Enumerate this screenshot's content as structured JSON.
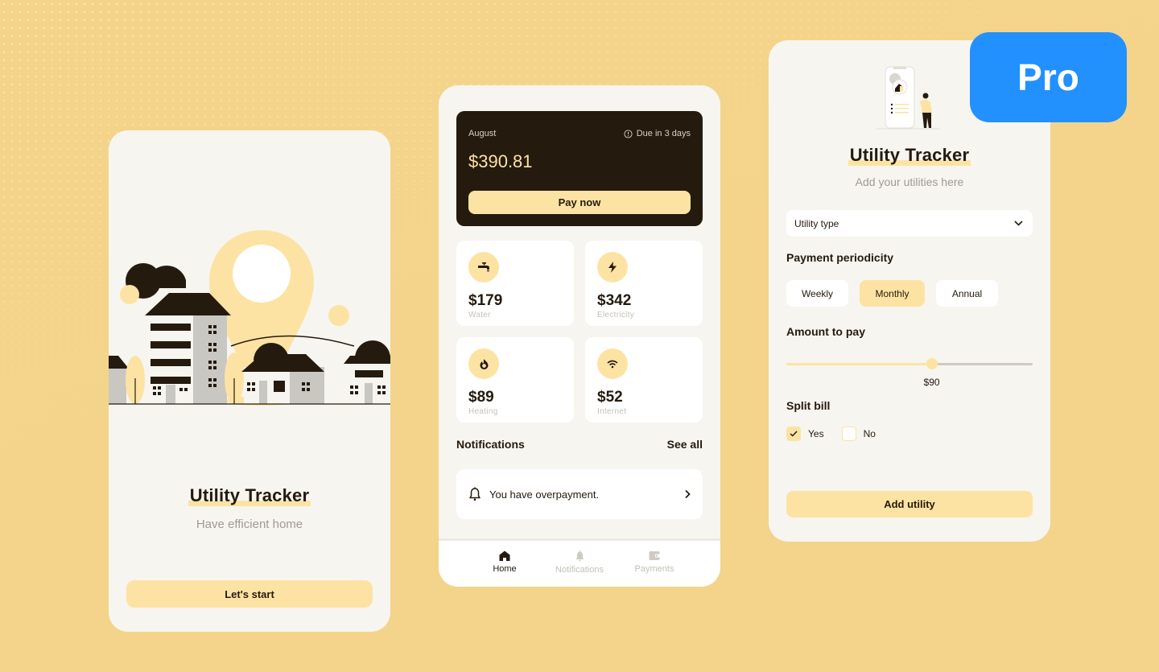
{
  "colors": {
    "background": "#f3d48a",
    "card_bg": "#f7f5f0",
    "accent_yellow": "#fde3a3",
    "dark": "#241a0e",
    "pro_blue": "#2291fe",
    "muted_text": "#a09a91"
  },
  "pro_badge": {
    "label": "Pro"
  },
  "onboarding": {
    "illustration": "city-houses-location-pin-illustration",
    "title": "Utility Tracker",
    "subtitle": "Have efficient home",
    "start_button": "Let's start"
  },
  "dashboard": {
    "bill": {
      "month": "August",
      "due_icon": "alert-circle-icon",
      "due": "Due in 3 days",
      "amount": "$390.81",
      "pay_button": "Pay now"
    },
    "utilities": [
      {
        "icon": "faucet-icon",
        "amount": "$179",
        "label": "Water"
      },
      {
        "icon": "lightning-icon",
        "amount": "$342",
        "label": "Electricity"
      },
      {
        "icon": "flame-icon",
        "amount": "$89",
        "label": "Heating"
      },
      {
        "icon": "wifi-icon",
        "amount": "$52",
        "label": "Internet"
      }
    ],
    "notifications": {
      "heading": "Notifications",
      "see_all": "See all",
      "items": [
        {
          "icon": "bell-icon",
          "text": "You have overpayment."
        }
      ]
    },
    "tabbar": [
      {
        "icon": "home-icon",
        "label": "Home",
        "active": true
      },
      {
        "icon": "bell-icon",
        "label": "Notifications",
        "active": false
      },
      {
        "icon": "wallet-icon",
        "label": "Payments",
        "active": false
      }
    ]
  },
  "add_utility": {
    "illustration": "phone-with-person-illustration",
    "title": "Utility Tracker",
    "subtitle": "Add your utilities here",
    "utility_type": {
      "placeholder": "Utility type"
    },
    "periodicity": {
      "label": "Payment periodicity",
      "options": [
        "Weekly",
        "Monthly",
        "Annual"
      ],
      "selected": "Monthly"
    },
    "amount": {
      "label": "Amount to pay",
      "value_label": "$90",
      "fraction": 0.59
    },
    "split_bill": {
      "label": "Split bill",
      "options": [
        {
          "label": "Yes",
          "checked": true
        },
        {
          "label": "No",
          "checked": false
        }
      ]
    },
    "submit_button": "Add utility"
  }
}
